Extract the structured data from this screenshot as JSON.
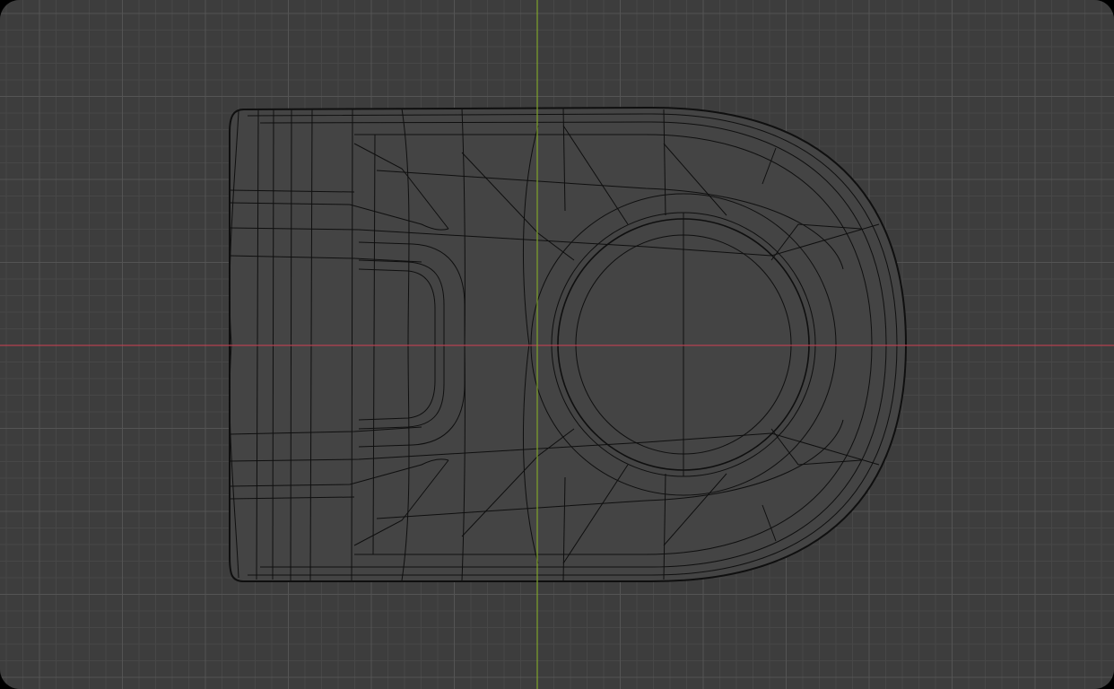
{
  "viewport": {
    "background_color": "#3d3d3d",
    "grid_minor_color": "#474747",
    "grid_major_color": "#545454",
    "x_axis_color": "#b34150",
    "y_axis_color": "#7fa32b",
    "wire_color": "#0f0f0f",
    "mesh_fill_color": "#444444"
  },
  "object": {
    "shape": "d-shaped-tab-with-circular-hole-and-rounded-rectangular-pocket",
    "display_mode": "wireframe"
  }
}
